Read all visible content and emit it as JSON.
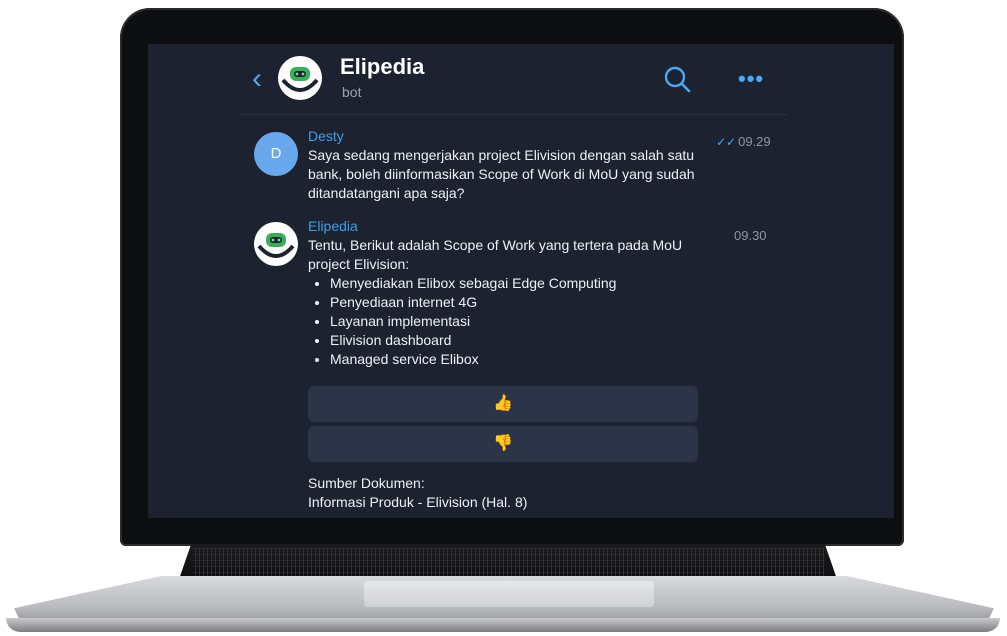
{
  "header": {
    "back_icon": "chevron-left-icon",
    "title": "Elipedia",
    "subtitle": "bot",
    "search_icon": "search-icon",
    "more_icon": "more-horizontal-icon",
    "more_glyph": "•••",
    "back_glyph": "‹"
  },
  "messages": [
    {
      "sender": "Desty",
      "avatar_initial": "D",
      "time": "09.29",
      "status": "read",
      "ticks_glyph": "✓✓",
      "text": "Saya sedang mengerjakan project Elivision dengan salah satu bank, boleh diinformasikan Scope of Work di MoU yang sudah ditandatangani apa saja?"
    },
    {
      "sender": "Elipedia",
      "time": "09.30",
      "intro": "Tentu, Berikut adalah Scope of Work yang tertera pada MoU project Elivision:",
      "points": [
        "Menyediakan Elibox sebagai Edge Computing",
        "Penyediaan internet 4G",
        "Layanan implementasi",
        "Elivision dashboard",
        "Managed service Elibox"
      ],
      "thumbs_up": "👍",
      "thumbs_down": "👎",
      "source_label": "Sumber Dokumen:",
      "source_value": "Informasi Produk - Elivision (Hal. 8)"
    }
  ],
  "colors": {
    "screen_bg": "#1c2230",
    "accent": "#4aa8f5",
    "button_bg": "#2c3547",
    "text": "#eef1f6",
    "muted": "#8d97a8"
  }
}
